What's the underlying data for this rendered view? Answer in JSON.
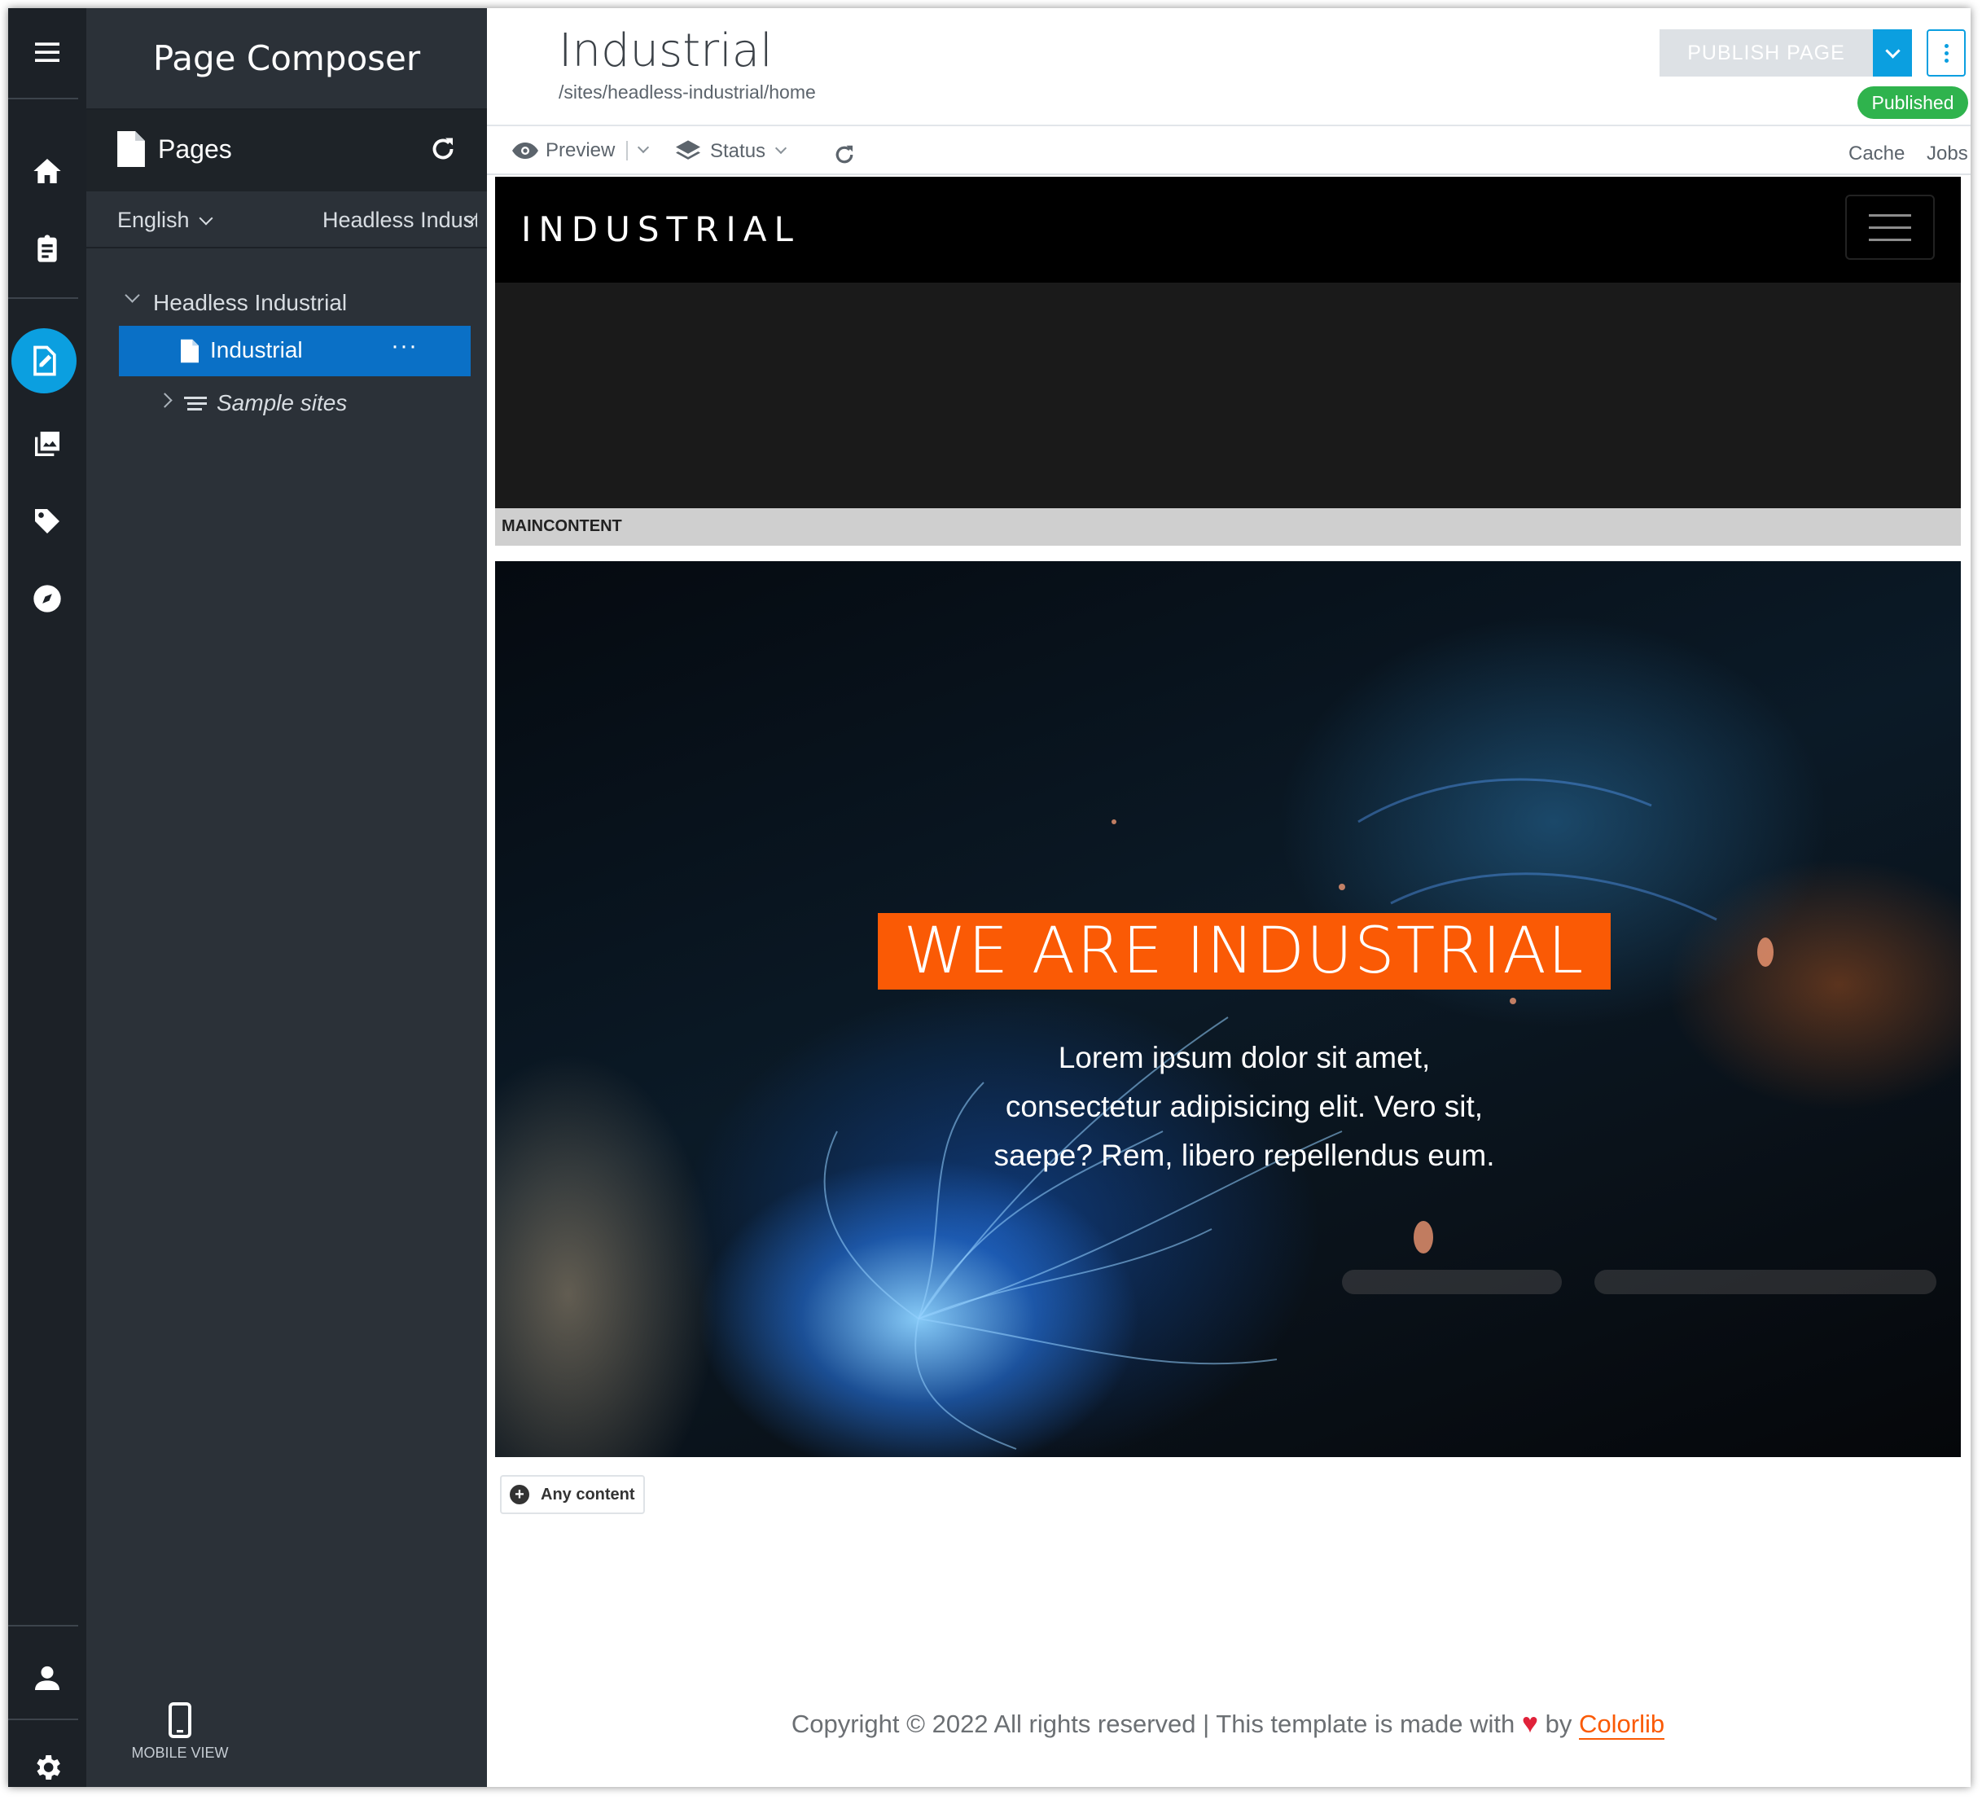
{
  "sidebar": {
    "app_title": "Page Composer",
    "pages_label": "Pages",
    "language": "English",
    "site_filter": "Headless Industrial",
    "tree": {
      "root": "Headless Industrial",
      "current": "Industrial",
      "current_more": "···",
      "sample": "Sample sites"
    },
    "mobile_view": "MOBILE VIEW"
  },
  "header": {
    "title": "Industrial",
    "path": "/sites/headless-industrial/home",
    "publish": "PUBLISH PAGE",
    "status_badge": "Published"
  },
  "toolbar": {
    "preview": "Preview",
    "status": "Status",
    "cache": "Cache",
    "jobs": "Jobs"
  },
  "site": {
    "brand": "INDUSTRIAL",
    "section_label": "MAINCONTENT",
    "hero_title": "WE ARE INDUSTRIAL",
    "hero_line1": "Lorem ipsum dolor sit amet,",
    "hero_line2": "consectetur adipisicing elit. Vero sit,",
    "hero_line3": "saepe? Rem, libero repellendus eum.",
    "any_content": "Any content",
    "footer_text": "Copyright © 2022 All rights reserved | This template is made with",
    "footer_by": "by",
    "footer_link": "Colorlib"
  },
  "colors": {
    "accent": "#0b9fe0",
    "selected": "#0a70c6",
    "hero_orange": "#fa5a05",
    "published": "#2fb34d"
  }
}
